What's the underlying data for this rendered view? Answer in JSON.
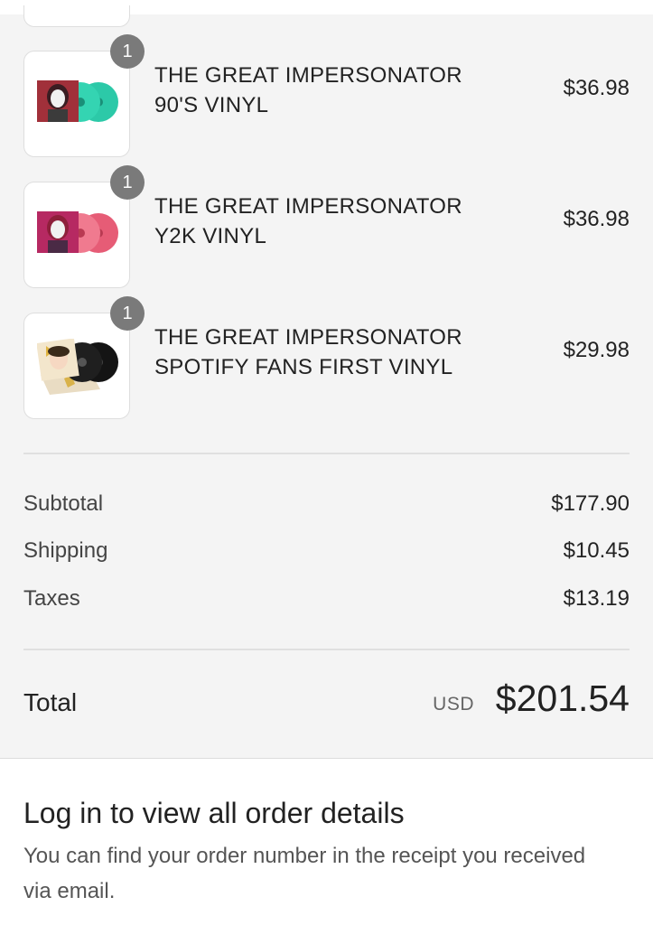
{
  "order_items": [
    {
      "title_line1": "THE GREAT IMPERSONATOR",
      "title_line2": "90'S VINYL",
      "price": "$36.98",
      "quantity": "1",
      "vinyl_color": "#2cc9a8",
      "thumb_icon": "album-cover-with-teal-vinyl-icon"
    },
    {
      "title_line1": "THE GREAT IMPERSONATOR",
      "title_line2": "Y2K VINYL",
      "price": "$36.98",
      "quantity": "1",
      "vinyl_color": "#ee6f86",
      "thumb_icon": "album-cover-with-pink-vinyl-icon"
    },
    {
      "title_line1": "THE GREAT IMPERSONATOR",
      "title_line2": "SPOTIFY FANS FIRST VINYL",
      "price": "$29.98",
      "quantity": "1",
      "vinyl_color": "#141414",
      "thumb_icon": "album-cover-with-black-vinyl-icon"
    }
  ],
  "totals": {
    "subtotal_label": "Subtotal",
    "subtotal_value": "$177.90",
    "shipping_label": "Shipping",
    "shipping_value": "$10.45",
    "taxes_label": "Taxes",
    "taxes_value": "$13.19",
    "total_label": "Total",
    "currency": "USD",
    "total_value": "$201.54"
  },
  "login": {
    "title": "Log in to view all order details",
    "description": "You can find your order number in the receipt you received via email."
  }
}
